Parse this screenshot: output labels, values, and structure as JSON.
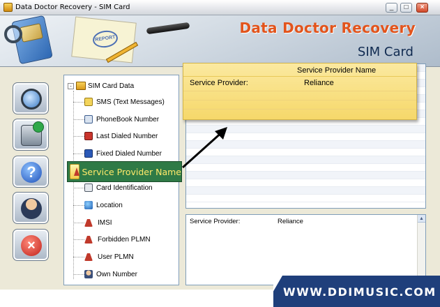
{
  "window": {
    "title": "Data Doctor Recovery - SIM Card",
    "minimize": "_",
    "maximize": "□",
    "close": "×"
  },
  "banner": {
    "title": "Data Doctor Recovery",
    "subtitle": "SIM Card",
    "stamp_text": "REPORT"
  },
  "toolbar": {
    "buttons": [
      {
        "name": "search",
        "icon": "search-icon"
      },
      {
        "name": "save",
        "icon": "save-icon"
      },
      {
        "name": "help",
        "icon": "help-icon",
        "glyph": "?"
      },
      {
        "name": "about",
        "icon": "user-icon"
      },
      {
        "name": "exit",
        "icon": "exit-icon",
        "glyph": "×"
      }
    ]
  },
  "tree": {
    "root": {
      "label": "SIM Card Data",
      "expander": "-"
    },
    "items": [
      {
        "label": "SMS (Text Messages)",
        "icon": "sms-icon"
      },
      {
        "label": "PhoneBook Number",
        "icon": "phonebook-icon"
      },
      {
        "label": "Last Dialed Number",
        "icon": "phone-icon"
      },
      {
        "label": "Fixed Dialed Number",
        "icon": "phone-icon"
      },
      {
        "label": "Service Provider Name",
        "icon": "tower-icon"
      },
      {
        "label": "Card Identification",
        "icon": "card-icon"
      },
      {
        "label": "Location",
        "icon": "globe-icon"
      },
      {
        "label": "IMSI",
        "icon": "tower-icon"
      },
      {
        "label": "Forbidden PLMN",
        "icon": "tower-icon"
      },
      {
        "label": "User PLMN",
        "icon": "tower-icon"
      },
      {
        "label": "Own Number",
        "icon": "person-icon"
      }
    ],
    "selected": "Service Provider Name"
  },
  "callout": {
    "header": "Service Provider Name",
    "row_key": "Service Provider:",
    "row_value": "Reliance"
  },
  "details": {
    "key": "Service Provider:",
    "value": "Reliance"
  },
  "footer": {
    "site": "WWW.DDIMUSIC.COM"
  }
}
